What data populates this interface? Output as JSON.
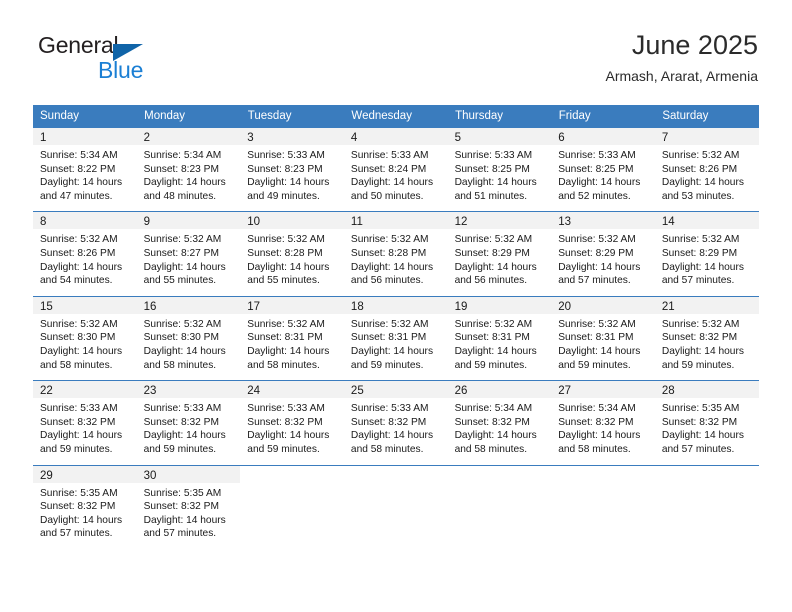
{
  "brand": {
    "word_general": "General",
    "word_blue": "Blue",
    "logo_icon": "triangle-flag-icon"
  },
  "header": {
    "title": "June 2025",
    "subtitle": "Armash, Ararat, Armenia"
  },
  "theme": {
    "header_blue": "#3a7cbe",
    "brand_blue": "#1b7fd4",
    "logo_blue": "#1064a8",
    "daynum_bg": "#f2f2f2",
    "text": "#1a1a1a"
  },
  "calendar": {
    "day_headers": [
      "Sunday",
      "Monday",
      "Tuesday",
      "Wednesday",
      "Thursday",
      "Friday",
      "Saturday"
    ],
    "weeks": [
      [
        {
          "day": "1",
          "sunrise": "Sunrise: 5:34 AM",
          "sunset": "Sunset: 8:22 PM",
          "daylight1": "Daylight: 14 hours",
          "daylight2": "and 47 minutes."
        },
        {
          "day": "2",
          "sunrise": "Sunrise: 5:34 AM",
          "sunset": "Sunset: 8:23 PM",
          "daylight1": "Daylight: 14 hours",
          "daylight2": "and 48 minutes."
        },
        {
          "day": "3",
          "sunrise": "Sunrise: 5:33 AM",
          "sunset": "Sunset: 8:23 PM",
          "daylight1": "Daylight: 14 hours",
          "daylight2": "and 49 minutes."
        },
        {
          "day": "4",
          "sunrise": "Sunrise: 5:33 AM",
          "sunset": "Sunset: 8:24 PM",
          "daylight1": "Daylight: 14 hours",
          "daylight2": "and 50 minutes."
        },
        {
          "day": "5",
          "sunrise": "Sunrise: 5:33 AM",
          "sunset": "Sunset: 8:25 PM",
          "daylight1": "Daylight: 14 hours",
          "daylight2": "and 51 minutes."
        },
        {
          "day": "6",
          "sunrise": "Sunrise: 5:33 AM",
          "sunset": "Sunset: 8:25 PM",
          "daylight1": "Daylight: 14 hours",
          "daylight2": "and 52 minutes."
        },
        {
          "day": "7",
          "sunrise": "Sunrise: 5:32 AM",
          "sunset": "Sunset: 8:26 PM",
          "daylight1": "Daylight: 14 hours",
          "daylight2": "and 53 minutes."
        }
      ],
      [
        {
          "day": "8",
          "sunrise": "Sunrise: 5:32 AM",
          "sunset": "Sunset: 8:26 PM",
          "daylight1": "Daylight: 14 hours",
          "daylight2": "and 54 minutes."
        },
        {
          "day": "9",
          "sunrise": "Sunrise: 5:32 AM",
          "sunset": "Sunset: 8:27 PM",
          "daylight1": "Daylight: 14 hours",
          "daylight2": "and 55 minutes."
        },
        {
          "day": "10",
          "sunrise": "Sunrise: 5:32 AM",
          "sunset": "Sunset: 8:28 PM",
          "daylight1": "Daylight: 14 hours",
          "daylight2": "and 55 minutes."
        },
        {
          "day": "11",
          "sunrise": "Sunrise: 5:32 AM",
          "sunset": "Sunset: 8:28 PM",
          "daylight1": "Daylight: 14 hours",
          "daylight2": "and 56 minutes."
        },
        {
          "day": "12",
          "sunrise": "Sunrise: 5:32 AM",
          "sunset": "Sunset: 8:29 PM",
          "daylight1": "Daylight: 14 hours",
          "daylight2": "and 56 minutes."
        },
        {
          "day": "13",
          "sunrise": "Sunrise: 5:32 AM",
          "sunset": "Sunset: 8:29 PM",
          "daylight1": "Daylight: 14 hours",
          "daylight2": "and 57 minutes."
        },
        {
          "day": "14",
          "sunrise": "Sunrise: 5:32 AM",
          "sunset": "Sunset: 8:29 PM",
          "daylight1": "Daylight: 14 hours",
          "daylight2": "and 57 minutes."
        }
      ],
      [
        {
          "day": "15",
          "sunrise": "Sunrise: 5:32 AM",
          "sunset": "Sunset: 8:30 PM",
          "daylight1": "Daylight: 14 hours",
          "daylight2": "and 58 minutes."
        },
        {
          "day": "16",
          "sunrise": "Sunrise: 5:32 AM",
          "sunset": "Sunset: 8:30 PM",
          "daylight1": "Daylight: 14 hours",
          "daylight2": "and 58 minutes."
        },
        {
          "day": "17",
          "sunrise": "Sunrise: 5:32 AM",
          "sunset": "Sunset: 8:31 PM",
          "daylight1": "Daylight: 14 hours",
          "daylight2": "and 58 minutes."
        },
        {
          "day": "18",
          "sunrise": "Sunrise: 5:32 AM",
          "sunset": "Sunset: 8:31 PM",
          "daylight1": "Daylight: 14 hours",
          "daylight2": "and 59 minutes."
        },
        {
          "day": "19",
          "sunrise": "Sunrise: 5:32 AM",
          "sunset": "Sunset: 8:31 PM",
          "daylight1": "Daylight: 14 hours",
          "daylight2": "and 59 minutes."
        },
        {
          "day": "20",
          "sunrise": "Sunrise: 5:32 AM",
          "sunset": "Sunset: 8:31 PM",
          "daylight1": "Daylight: 14 hours",
          "daylight2": "and 59 minutes."
        },
        {
          "day": "21",
          "sunrise": "Sunrise: 5:32 AM",
          "sunset": "Sunset: 8:32 PM",
          "daylight1": "Daylight: 14 hours",
          "daylight2": "and 59 minutes."
        }
      ],
      [
        {
          "day": "22",
          "sunrise": "Sunrise: 5:33 AM",
          "sunset": "Sunset: 8:32 PM",
          "daylight1": "Daylight: 14 hours",
          "daylight2": "and 59 minutes."
        },
        {
          "day": "23",
          "sunrise": "Sunrise: 5:33 AM",
          "sunset": "Sunset: 8:32 PM",
          "daylight1": "Daylight: 14 hours",
          "daylight2": "and 59 minutes."
        },
        {
          "day": "24",
          "sunrise": "Sunrise: 5:33 AM",
          "sunset": "Sunset: 8:32 PM",
          "daylight1": "Daylight: 14 hours",
          "daylight2": "and 59 minutes."
        },
        {
          "day": "25",
          "sunrise": "Sunrise: 5:33 AM",
          "sunset": "Sunset: 8:32 PM",
          "daylight1": "Daylight: 14 hours",
          "daylight2": "and 58 minutes."
        },
        {
          "day": "26",
          "sunrise": "Sunrise: 5:34 AM",
          "sunset": "Sunset: 8:32 PM",
          "daylight1": "Daylight: 14 hours",
          "daylight2": "and 58 minutes."
        },
        {
          "day": "27",
          "sunrise": "Sunrise: 5:34 AM",
          "sunset": "Sunset: 8:32 PM",
          "daylight1": "Daylight: 14 hours",
          "daylight2": "and 58 minutes."
        },
        {
          "day": "28",
          "sunrise": "Sunrise: 5:35 AM",
          "sunset": "Sunset: 8:32 PM",
          "daylight1": "Daylight: 14 hours",
          "daylight2": "and 57 minutes."
        }
      ],
      [
        {
          "day": "29",
          "sunrise": "Sunrise: 5:35 AM",
          "sunset": "Sunset: 8:32 PM",
          "daylight1": "Daylight: 14 hours",
          "daylight2": "and 57 minutes."
        },
        {
          "day": "30",
          "sunrise": "Sunrise: 5:35 AM",
          "sunset": "Sunset: 8:32 PM",
          "daylight1": "Daylight: 14 hours",
          "daylight2": "and 57 minutes."
        },
        {
          "day": "",
          "sunrise": "",
          "sunset": "",
          "daylight1": "",
          "daylight2": ""
        },
        {
          "day": "",
          "sunrise": "",
          "sunset": "",
          "daylight1": "",
          "daylight2": ""
        },
        {
          "day": "",
          "sunrise": "",
          "sunset": "",
          "daylight1": "",
          "daylight2": ""
        },
        {
          "day": "",
          "sunrise": "",
          "sunset": "",
          "daylight1": "",
          "daylight2": ""
        },
        {
          "day": "",
          "sunrise": "",
          "sunset": "",
          "daylight1": "",
          "daylight2": ""
        }
      ]
    ]
  }
}
